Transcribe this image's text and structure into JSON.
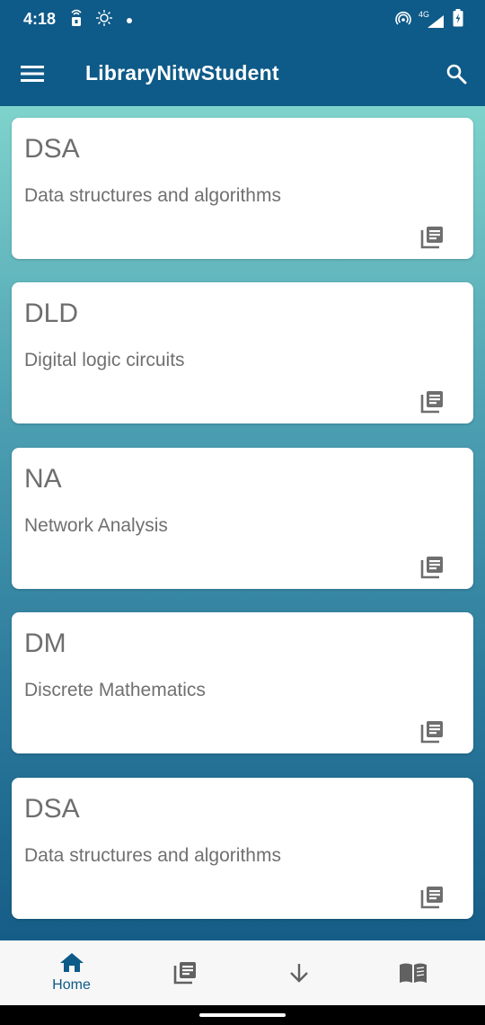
{
  "status_bar": {
    "time": "4:18",
    "left_icons": [
      "notification-lock-icon",
      "brightness-icon",
      "dot-icon"
    ],
    "right_icons": [
      "hotspot-icon",
      "signal-4g-icon",
      "battery-charging-icon"
    ],
    "network_label": "4G"
  },
  "app_bar": {
    "title": "LibraryNitwStudent",
    "color": "#0e5a88"
  },
  "courses": [
    {
      "code": "DSA",
      "name": "Data structures and algorithms",
      "icon": "library-books-icon"
    },
    {
      "code": "DLD",
      "name": "Digital logic circuits",
      "icon": "library-books-icon"
    },
    {
      "code": "NA",
      "name": "Network Analysis",
      "icon": "library-books-icon"
    },
    {
      "code": "DM",
      "name": "Discrete Mathematics",
      "icon": "library-books-icon"
    },
    {
      "code": "DSA",
      "name": "Data structures and algorithms",
      "icon": "library-books-icon"
    }
  ],
  "bottom_nav": {
    "items": [
      {
        "label": "Home",
        "icon": "home-icon",
        "active": true
      },
      {
        "label": "",
        "icon": "library-books-icon",
        "active": false
      },
      {
        "label": "",
        "icon": "arrow-down-icon",
        "active": false
      },
      {
        "label": "",
        "icon": "open-book-icon",
        "active": false
      }
    ],
    "active_color": "#0e5a88",
    "inactive_color": "#616161"
  }
}
